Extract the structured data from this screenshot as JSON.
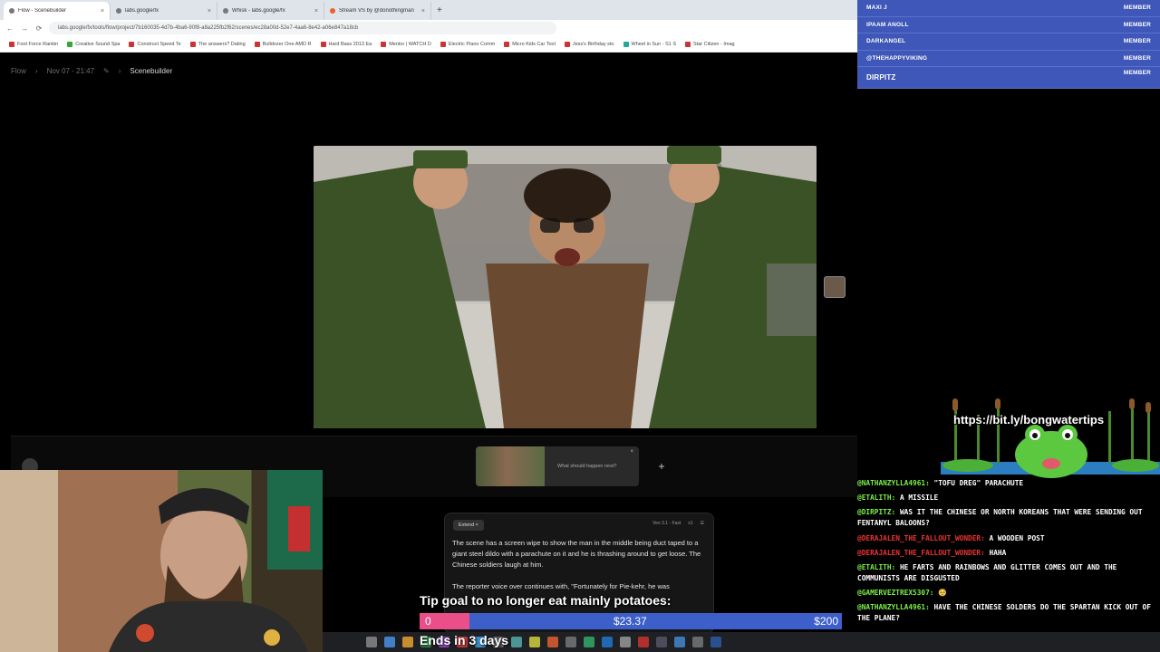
{
  "browser": {
    "tabs": [
      {
        "label": "Flow - Scenebuilder",
        "active": true
      },
      {
        "label": "labs.google/fx",
        "active": false
      },
      {
        "label": "Whisk - labs.google/fx",
        "active": false
      },
      {
        "label": "Stream VS by @donothingman",
        "active": false
      }
    ],
    "new_tab": "+",
    "url": "labs.google/fx/tools/flow/project/7b160035-4d7b-4ba6-90f8-a8a225fb2f62/scenes/ec28a00d-52e7-4aa6-8e42-a06e847a18cb",
    "bookmarks": [
      "Foot Force Rankin",
      "Creative Sound Spa",
      "Construct Speed Te",
      "The answers? Dating",
      "Bulldozer One AMD R",
      "Hard Bass 2013 Ea",
      "Mentor | WATCH D",
      "Electric Piano Comm",
      "Micro Kids Car Tool",
      "Jess's Birthday sto",
      "Wheel in Sun - S1 S",
      "Star Citizen - Imag"
    ]
  },
  "app": {
    "breadcrumb": {
      "root": "Flow",
      "project": "Nov 07 - 21:47",
      "current": "Scenebuilder"
    }
  },
  "timeline": {
    "clip_prompt_placeholder": "What should happen next?",
    "close": "×",
    "add": "+"
  },
  "prompt_panel": {
    "chip": "Extend",
    "chip_close": "×",
    "model": "Veo 3.1 - Fast",
    "count": "x1",
    "text_1": "The scene has a screen wipe to show the man in the middle being duct taped to a giant steel dildo with a parachute on it and he is thrashing around to get loose. The Chinese soldiers laugh at him.",
    "text_2": "The reporter voice over continues with, \"Fortunately for Pie-kehr, he was"
  },
  "tip_goal": {
    "title": "Tip goal to no longer eat mainly potatoes:",
    "start": "0",
    "current": "$23.37",
    "goal": "$200",
    "progress": 0.117,
    "ends": "Ends in 3 days",
    "colors": {
      "fill": "#ea4f8a",
      "bar": "#3d5fc9"
    }
  },
  "members": [
    {
      "name": "MAXI J",
      "role": "MEMBER"
    },
    {
      "name": "IPAAM ANOLL",
      "role": "MEMBER"
    },
    {
      "name": "DARKANGEL",
      "role": "MEMBER"
    },
    {
      "name": "@THEHAPPYVIKING",
      "role": "MEMBER"
    },
    {
      "name": "DIRPITZ",
      "role": "MEMBER"
    }
  ],
  "banner": {
    "url": "https://bit.ly/bongwatertips"
  },
  "chat": [
    {
      "user": "@NATHANZYLLA4961:",
      "msg": "\"TOFU DREG\" PARACHUTE",
      "red": false
    },
    {
      "user": "@ETALITH:",
      "msg": "A MISSILE",
      "red": false
    },
    {
      "user": "@DIRPITZ:",
      "msg": "WAS IT THE CHINESE OR NORTH KOREANS THAT WERE SENDING OUT FENTANYL BALOONS?",
      "red": false
    },
    {
      "user": "@DERAJALEN_THE_FALLOUT_WONDER:",
      "msg": "A WOODEN POST",
      "red": true
    },
    {
      "user": "@DERAJALEN_THE_FALLOUT_WONDER:",
      "msg": "HAHA",
      "red": true
    },
    {
      "user": "@ETALITH:",
      "msg": "HE FARTS AND RAINBOWS AND GLITTER COMES OUT AND THE COMMUNISTS ARE DISGUSTED",
      "red": false
    },
    {
      "user": "@GAMERVEZTREX5307:",
      "msg": "🥺",
      "red": true
    },
    {
      "user": "@NATHANZYLLA4961:",
      "msg": "HAVE THE CHINESE SOLDERS DO THE SPARTAN KICK OUT OF THE PLANE?",
      "red": false
    }
  ]
}
